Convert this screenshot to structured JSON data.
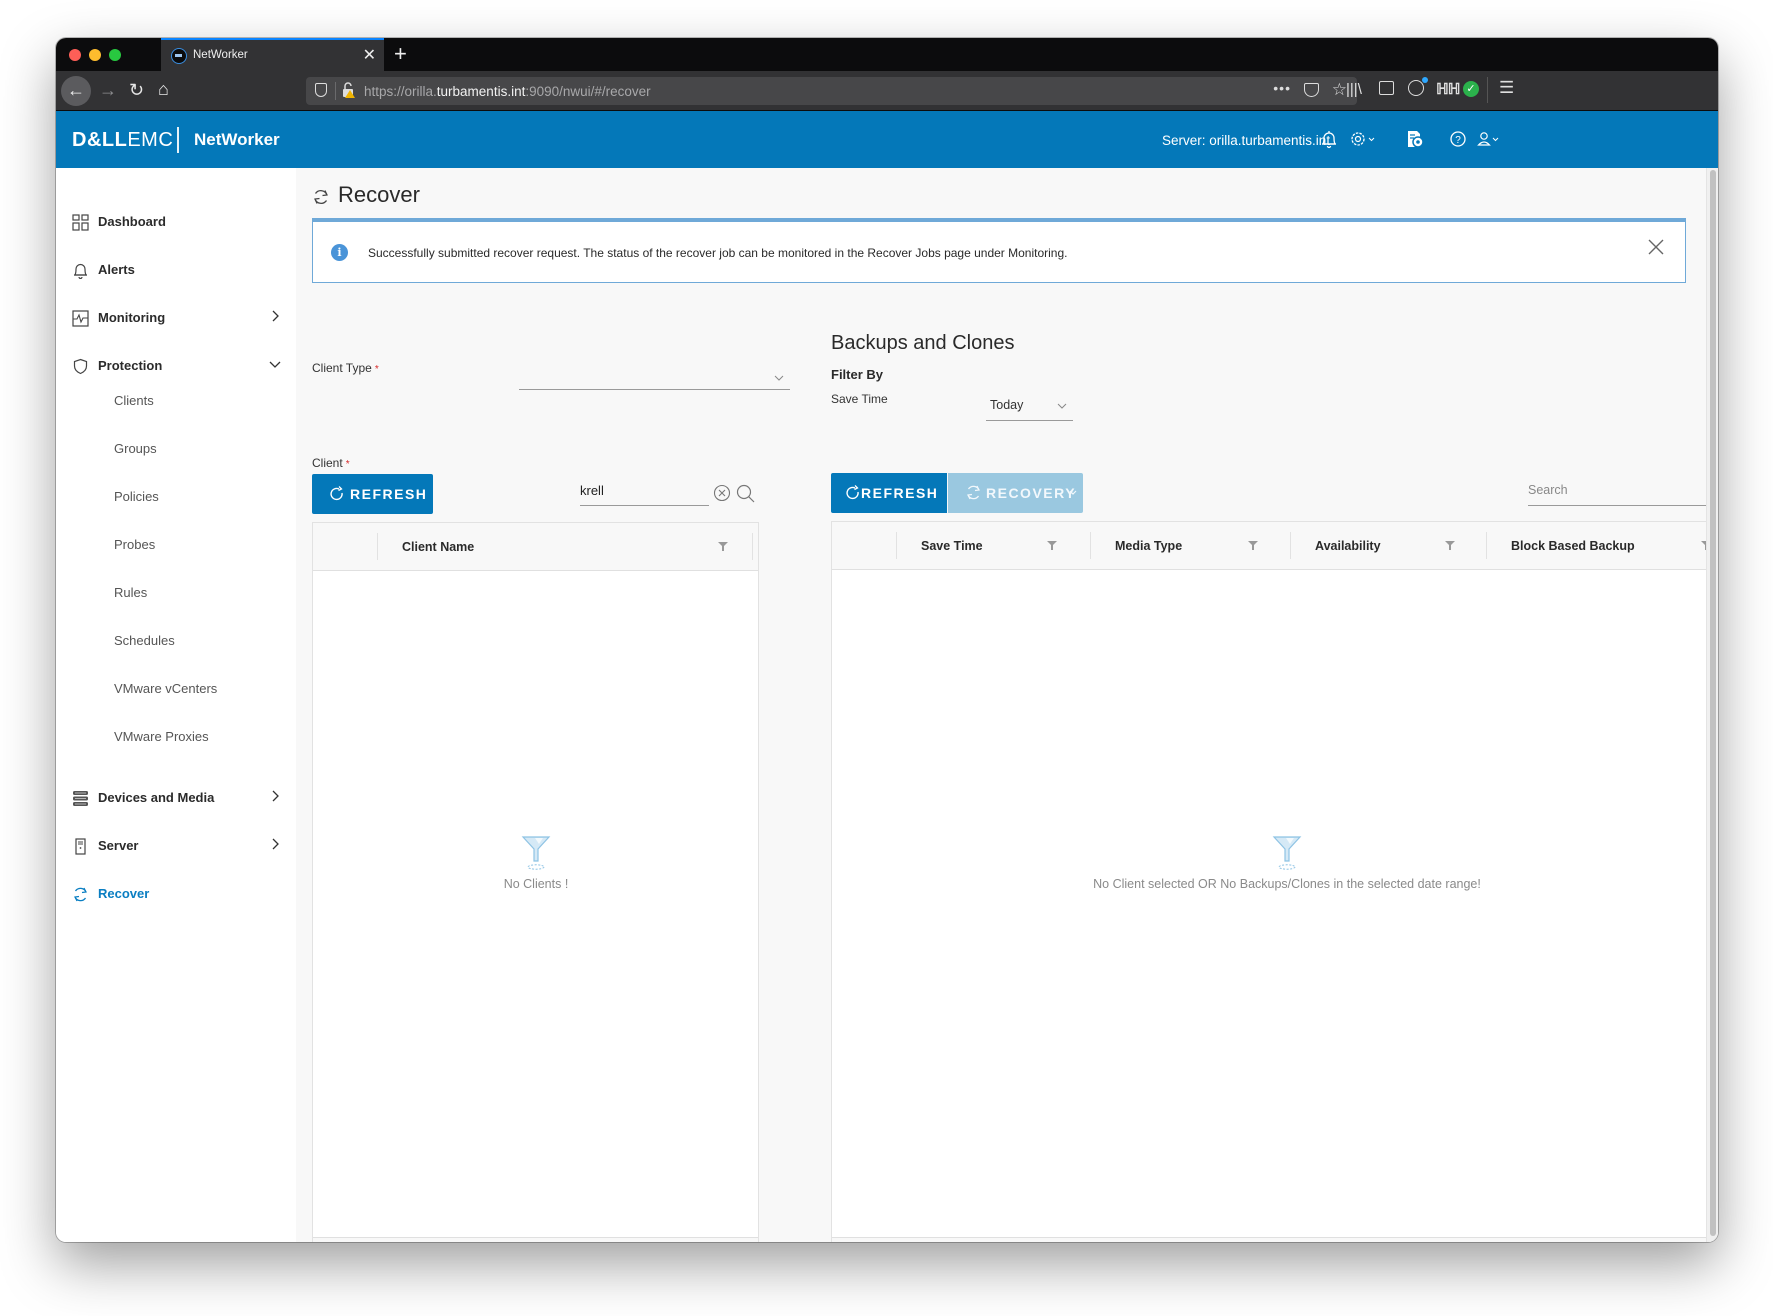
{
  "browser": {
    "tab_title": "NetWorker",
    "url_prefix": "https://orilla.",
    "url_domain": "turbamentis.int",
    "url_suffix": ":9090/nwui/#/recover"
  },
  "app": {
    "brand_dell": "D&LL",
    "brand_emc": "EMC",
    "product": "NetWorker",
    "server_label": "Server: orilla.turbamentis.int",
    "accent_color": "#0478b9"
  },
  "sidebar": {
    "items": [
      {
        "label": "Dashboard",
        "icon": "dashboard-icon"
      },
      {
        "label": "Alerts",
        "icon": "bell-icon"
      },
      {
        "label": "Monitoring",
        "icon": "monitoring-icon",
        "chevron": "right"
      },
      {
        "label": "Protection",
        "icon": "shield-icon",
        "chevron": "down"
      },
      {
        "label": "Devices and Media",
        "icon": "storage-icon",
        "chevron": "right"
      },
      {
        "label": "Server",
        "icon": "server-icon",
        "chevron": "right"
      },
      {
        "label": "Recover",
        "icon": "recover-icon",
        "active": true
      }
    ],
    "protection_sub": [
      "Clients",
      "Groups",
      "Policies",
      "Probes",
      "Rules",
      "Schedules",
      "VMware vCenters",
      "VMware Proxies"
    ]
  },
  "page": {
    "title": "Recover",
    "alert_message": "Successfully submitted recover request. The status of the recover job can be monitored in the Recover Jobs page under Monitoring."
  },
  "client_panel": {
    "client_type_label": "Client Type",
    "client_type_value": "",
    "client_label": "Client",
    "required_mark": "*",
    "refresh_label": "REFRESH",
    "search_value": "krell",
    "columns": [
      "Client Name"
    ],
    "empty_message": "No Clients !"
  },
  "backups_panel": {
    "title": "Backups and Clones",
    "filter_by_label": "Filter By",
    "save_time_label": "Save Time",
    "save_time_value": "Today",
    "refresh_label": "REFRESH",
    "recovery_label": "RECOVERY",
    "search_placeholder": "Search",
    "columns": [
      "Save Time",
      "Media Type",
      "Availability",
      "Block Based Backup"
    ],
    "empty_message": "No Client selected OR No Backups/Clones in the selected date range!"
  }
}
